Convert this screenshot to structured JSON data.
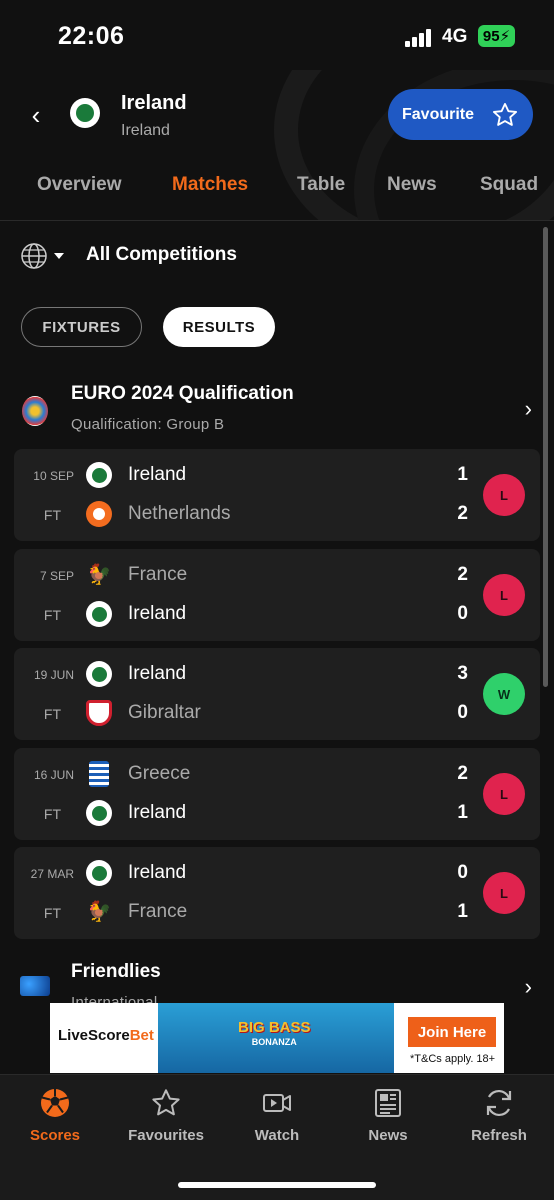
{
  "status": {
    "time": "22:06",
    "network": "4G",
    "battery": "95"
  },
  "header": {
    "team_name": "Ireland",
    "team_country": "Ireland",
    "favourite_label": "Favourite",
    "tabs": [
      {
        "label": "Overview",
        "active": false
      },
      {
        "label": "Matches",
        "active": true
      },
      {
        "label": "Table",
        "active": false
      },
      {
        "label": "News",
        "active": false
      },
      {
        "label": "Squad",
        "active": false
      }
    ]
  },
  "filters": {
    "competition": "All Competitions",
    "fixtures_label": "FIXTURES",
    "results_label": "RESULTS"
  },
  "leagues": [
    {
      "name": "EURO 2024 Qualification",
      "sub": "Qualification: Group B"
    },
    {
      "name": "Friendlies",
      "sub": "International"
    }
  ],
  "matches": [
    {
      "date": "10 SEP",
      "status": "FT",
      "home": "Ireland",
      "away": "Netherlands",
      "home_score": "1",
      "away_score": "2",
      "result": "L"
    },
    {
      "date": "7 SEP",
      "status": "FT",
      "home": "France",
      "away": "Ireland",
      "home_score": "2",
      "away_score": "0",
      "result": "L"
    },
    {
      "date": "19 JUN",
      "status": "FT",
      "home": "Ireland",
      "away": "Gibraltar",
      "home_score": "3",
      "away_score": "0",
      "result": "W"
    },
    {
      "date": "16 JUN",
      "status": "FT",
      "home": "Greece",
      "away": "Ireland",
      "home_score": "2",
      "away_score": "1",
      "result": "L"
    },
    {
      "date": "27 MAR",
      "status": "FT",
      "home": "Ireland",
      "away": "France",
      "home_score": "0",
      "away_score": "1",
      "result": "L"
    }
  ],
  "ad": {
    "brand_a": "LiveScore",
    "brand_b": "Bet",
    "game_line1": "BIG BASS",
    "game_line2": "BONANZA",
    "cta": "Join Here",
    "terms": "*T&Cs apply. 18+"
  },
  "nav": [
    {
      "label": "Scores",
      "icon": "football-icon",
      "active": true
    },
    {
      "label": "Favourites",
      "icon": "star-icon",
      "active": false
    },
    {
      "label": "Watch",
      "icon": "video-icon",
      "active": false
    },
    {
      "label": "News",
      "icon": "newspaper-icon",
      "active": false
    },
    {
      "label": "Refresh",
      "icon": "refresh-icon",
      "active": false
    }
  ],
  "colors": {
    "accent": "#f26a1b",
    "favourite": "#1f59c4",
    "loss": "#e0234e",
    "win": "#2fd06b"
  }
}
